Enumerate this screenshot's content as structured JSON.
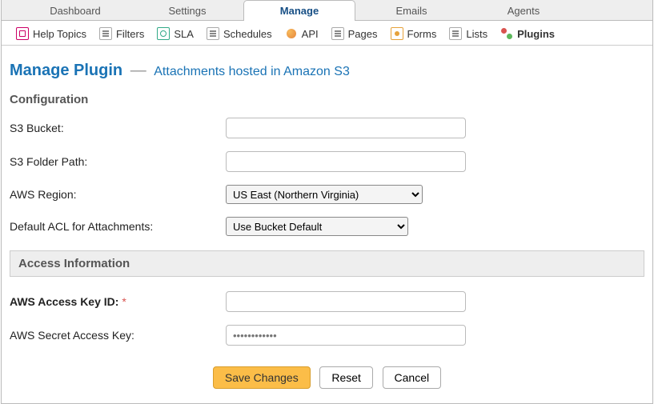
{
  "tabs": [
    {
      "label": "Dashboard"
    },
    {
      "label": "Settings"
    },
    {
      "label": "Manage"
    },
    {
      "label": "Emails"
    },
    {
      "label": "Agents"
    }
  ],
  "active_tab": "Manage",
  "subnav": [
    {
      "label": "Help Topics"
    },
    {
      "label": "Filters"
    },
    {
      "label": "SLA"
    },
    {
      "label": "Schedules"
    },
    {
      "label": "API"
    },
    {
      "label": "Pages"
    },
    {
      "label": "Forms"
    },
    {
      "label": "Lists"
    },
    {
      "label": "Plugins"
    }
  ],
  "active_subnav": "Plugins",
  "header": {
    "title": "Manage Plugin",
    "dash": "—",
    "subtitle": "Attachments hosted in Amazon S3"
  },
  "sections": {
    "config_label": "Configuration",
    "access_label": "Access Information"
  },
  "fields": {
    "bucket": {
      "label": "S3 Bucket:",
      "value": ""
    },
    "folder": {
      "label": "S3 Folder Path:",
      "value": ""
    },
    "region": {
      "label": "AWS Region:",
      "value": "US East (Northern Virginia)"
    },
    "acl": {
      "label": "Default ACL for Attachments:",
      "value": "Use Bucket Default"
    },
    "access_key": {
      "label": "AWS Access Key ID:",
      "required": "*",
      "value": ""
    },
    "secret_key": {
      "label": "AWS Secret Access Key:",
      "placeholder": "••••••••••••",
      "value": ""
    }
  },
  "buttons": {
    "save": "Save Changes",
    "reset": "Reset",
    "cancel": "Cancel"
  }
}
